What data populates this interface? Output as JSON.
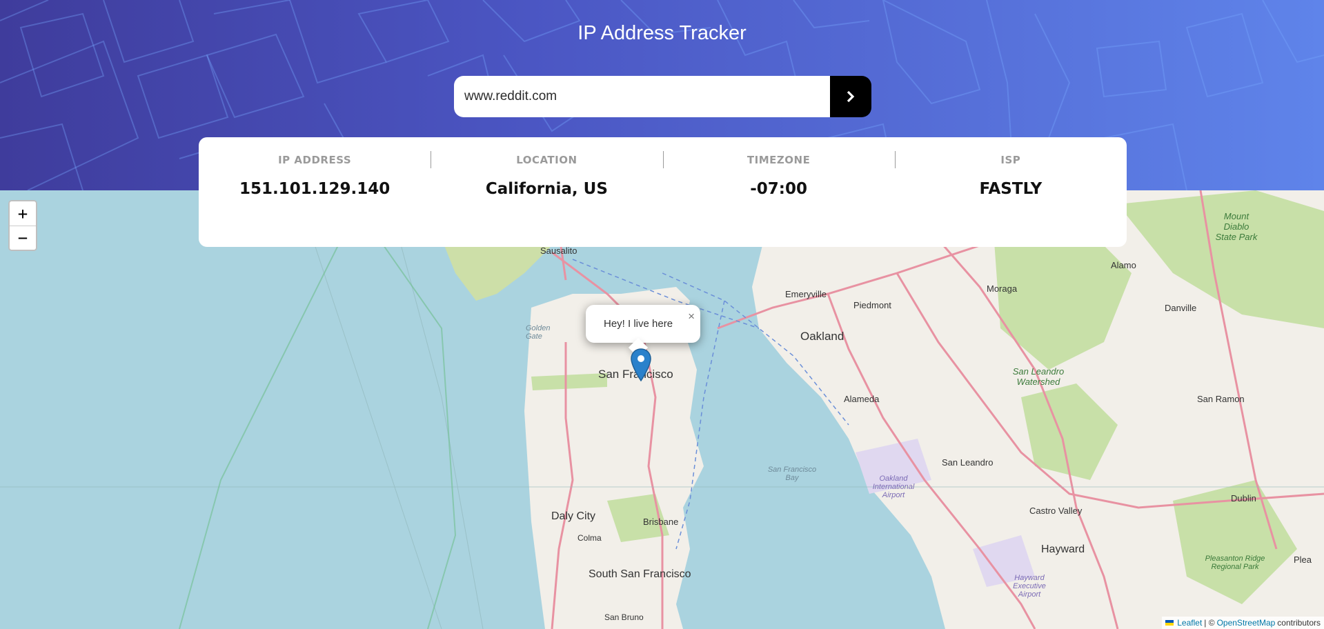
{
  "header": {
    "title": "IP Address Tracker"
  },
  "search": {
    "value": "www.reddit.com",
    "submit_icon": "chevron-right-icon"
  },
  "info": {
    "ip": {
      "label": "IP ADDRESS",
      "value": "151.101.129.140"
    },
    "location": {
      "label": "LOCATION",
      "value": "California, US"
    },
    "timezone": {
      "label": "TIMEZONE",
      "value": "-07:00"
    },
    "isp": {
      "label": "ISP",
      "value": "FASTLY"
    }
  },
  "map": {
    "zoom_in": "+",
    "zoom_out": "−",
    "popup_text": "Hey! I live here",
    "popup_close": "×",
    "attribution": {
      "leaflet": "Leaflet",
      "separator": "| ©",
      "osm": "OpenStreetMap",
      "contributors": "contributors"
    },
    "labels": {
      "san_francisco": "San Francisco",
      "oakland": "Oakland",
      "daly_city": "Daly City",
      "south_sf": "South San Francisco",
      "hayward": "Hayward",
      "sausalito": "Sausalito",
      "emeryville": "Emeryville",
      "piedmont": "Piedmont",
      "alameda": "Alameda",
      "san_leandro": "San Leandro",
      "castro_valley": "Castro Valley",
      "moraga": "Moraga",
      "danville": "Danville",
      "san_ramon": "San Ramon",
      "dublin": "Dublin",
      "alamo": "Alamo",
      "brisbane": "Brisbane",
      "colma": "Colma",
      "san_bruno": "San Bruno",
      "pleasanton": "Plea",
      "golden_gate": "Golden Gate",
      "sf_bay": "San Francisco Bay",
      "oakland_airport": "Oakland International Airport",
      "hayward_airport": "Hayward Executive Airport",
      "watershed": "San Leandro Watershed",
      "mount_diablo": "Mount Diablo State Park",
      "pleasanton_ridge": "Pleasanton Ridge Regional Park"
    },
    "colors": {
      "water": "#aad3df",
      "land": "#f2efe9",
      "park": "#c8e0a8",
      "highway": "#e892a2",
      "marker": "#2a81cb"
    }
  }
}
